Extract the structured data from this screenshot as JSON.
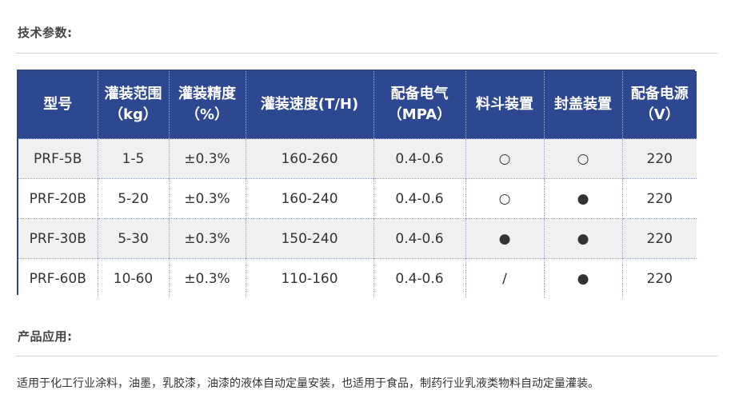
{
  "spec_section": {
    "title": "技术参数:"
  },
  "table": {
    "headers": [
      "型号",
      "灌装范围（kg）",
      "灌装精度（%）",
      "灌装速度(T/H)",
      "配备电气（MPA）",
      "料斗装置",
      "封盖装置",
      "配备电源（V）"
    ],
    "rows": [
      [
        "PRF-5B",
        "1-5",
        "±0.3%",
        "160-260",
        "0.4-0.6",
        "○",
        "○",
        "220"
      ],
      [
        "PRF-20B",
        "5-20",
        "±0.3%",
        "160-240",
        "0.4-0.6",
        "○",
        "●",
        "220"
      ],
      [
        "PRF-30B",
        "5-30",
        "±0.3%",
        "150-240",
        "0.4-0.6",
        "●",
        "●",
        "220"
      ],
      [
        "PRF-60B",
        "10-60",
        "±0.3%",
        "110-160",
        "0.4-0.6",
        "/",
        "●",
        "220"
      ]
    ]
  },
  "app_section": {
    "title": "产品应用:",
    "text": "适用于化工行业涂料，油墨，乳胶漆，油漆的液体自动定量安装，也适用于食品，制药行业乳液类物料自动定量灌装。"
  },
  "colors": {
    "header_bg": "#2e4791",
    "table_border": "#2d4587",
    "stripe": "#f0f0f0"
  }
}
